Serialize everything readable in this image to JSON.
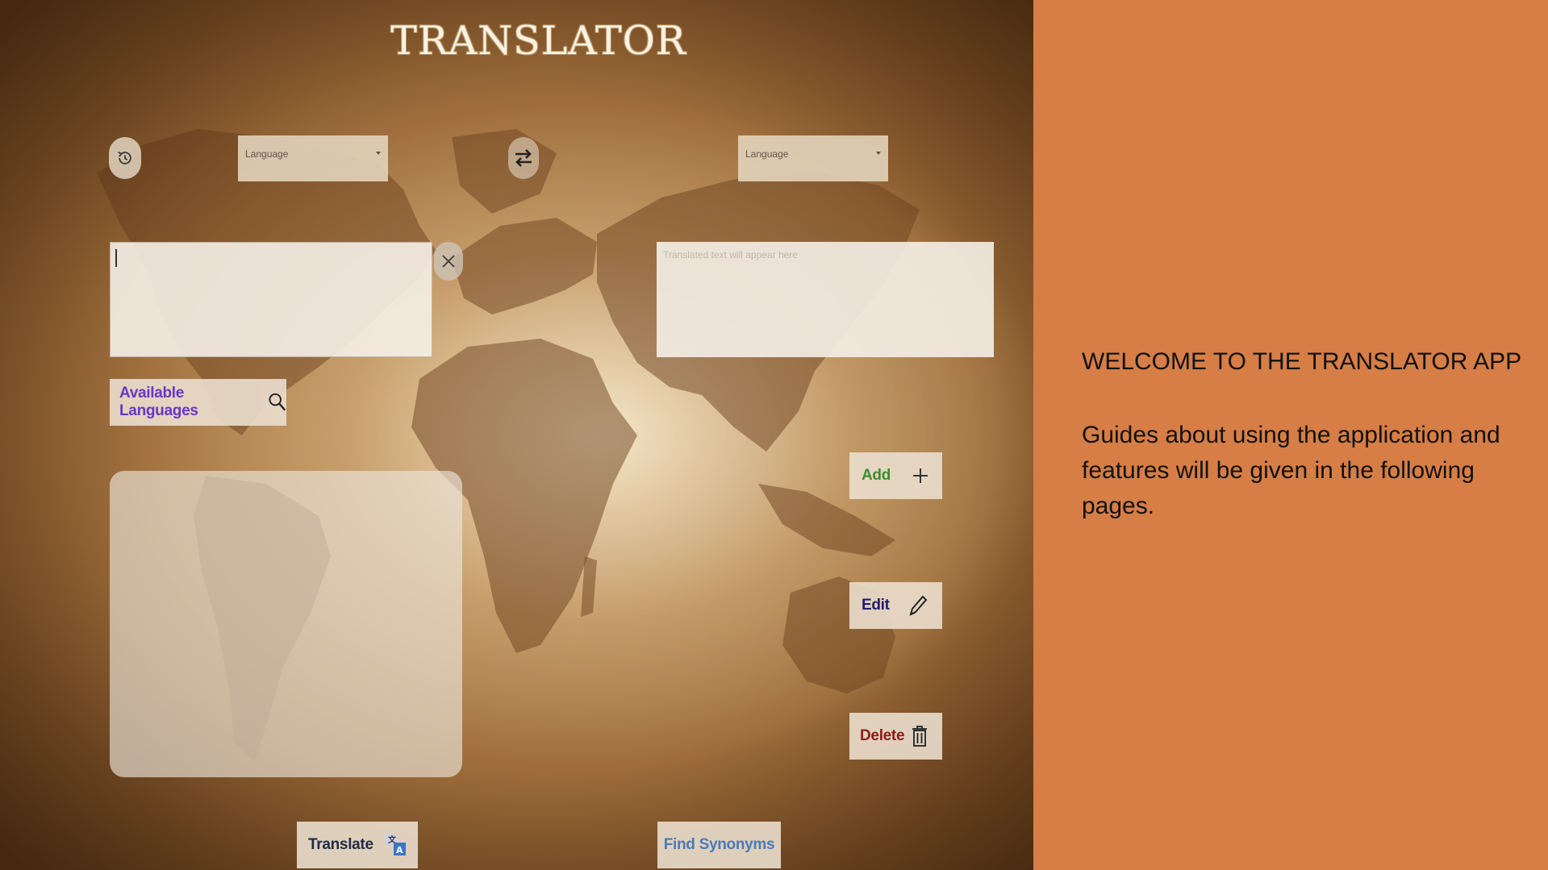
{
  "app": {
    "title": "TRANSLATOR",
    "source_language": {
      "selected": "Language"
    },
    "target_language": {
      "selected": "Language"
    },
    "input_text": {
      "value": ""
    },
    "output_text": {
      "placeholder": "Translated text will appear here"
    },
    "buttons": {
      "available_languages": "Available Languages",
      "add": "Add",
      "edit": "Edit",
      "delete": "Delete",
      "translate": "Translate",
      "find_synonyms": "Find Synonyms"
    },
    "icons": {
      "history": "history-icon",
      "swap": "swap-arrows-icon",
      "clear": "close-icon",
      "search": "search-icon",
      "add": "plus-icon",
      "edit": "pencil-icon",
      "delete": "trash-icon",
      "translate": "translate-icon"
    },
    "colors": {
      "available_languages_text": "#6a35c9",
      "add_text": "#3d8c2c",
      "edit_text": "#1e1b6e",
      "delete_text": "#8e1b1b",
      "translate_text": "#1f2b4a",
      "find_synonyms_text": "#4a7ab8"
    }
  },
  "welcome": {
    "heading": "WELCOME TO THE TRANSLATOR APP",
    "body": "Guides about using the application and features will be given in the following pages."
  },
  "colors": {
    "background": "#d67e46"
  }
}
